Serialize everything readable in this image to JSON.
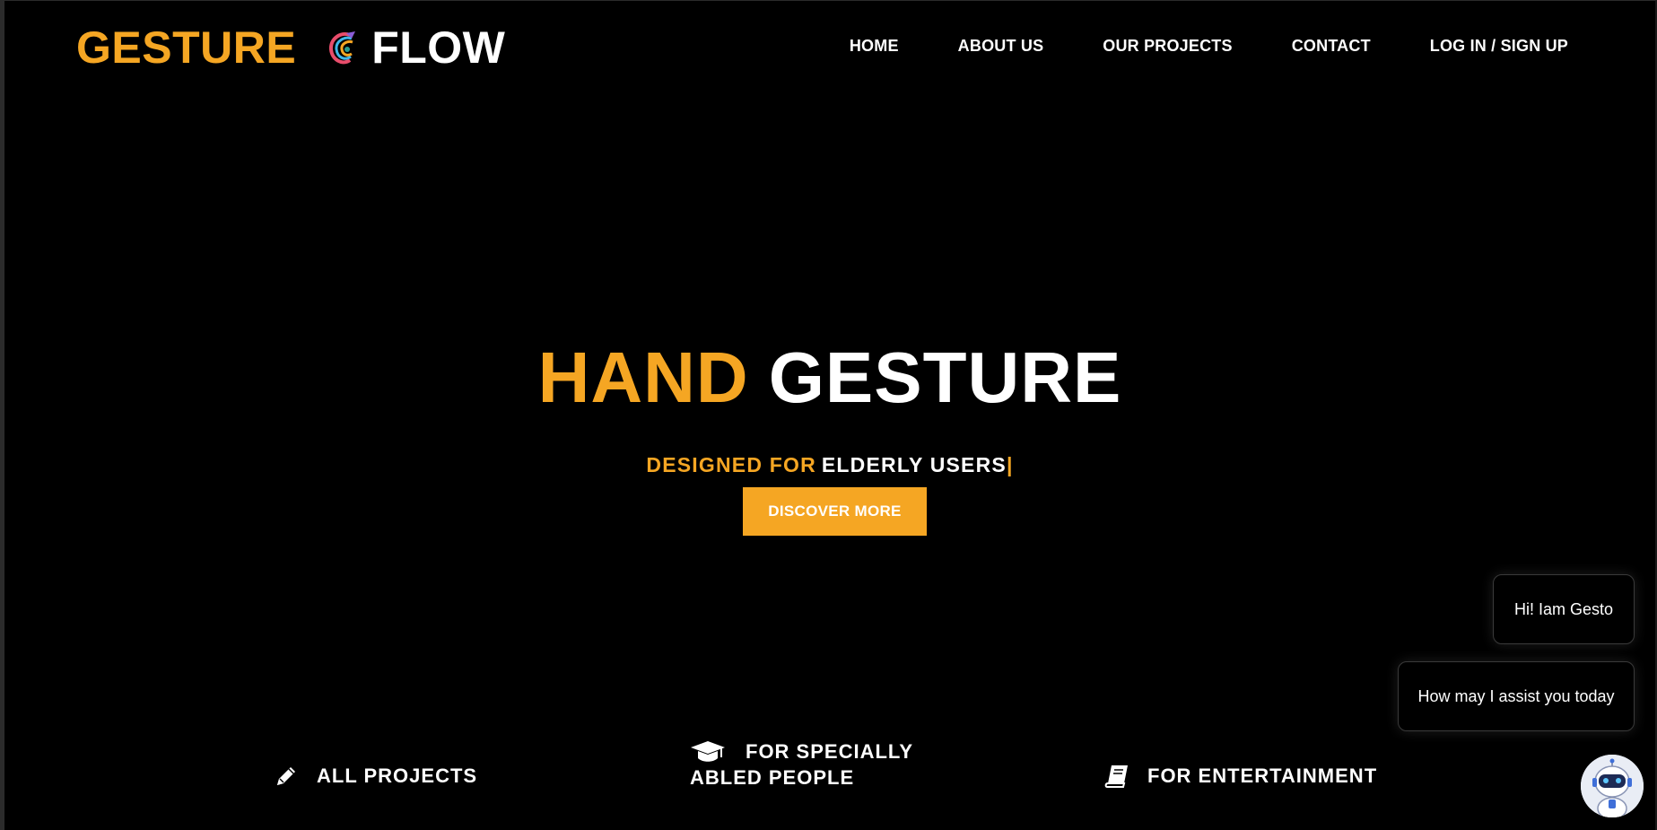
{
  "brand": {
    "word1": "GESTURE",
    "word2": "FLOW",
    "logo_icon": "swirl-hand-logo-icon"
  },
  "nav": {
    "items": [
      "HOME",
      "ABOUT US",
      "OUR PROJECTS",
      "CONTACT",
      "LOG IN / SIGN UP"
    ]
  },
  "hero": {
    "title_orange": "HAND",
    "title_white": "GESTURE",
    "subtitle_orange": "DESIGNED FOR",
    "subtitle_white": "ELDERLY USERS",
    "cursor": "|",
    "cta_label": "DISCOVER MORE"
  },
  "features": [
    {
      "icon": "pencil-icon",
      "label": "ALL PROJECTS"
    },
    {
      "icon": "graduation-cap-icon",
      "label_line1": "FOR SPECIALLY",
      "label_line2": "ABLED PEOPLE"
    },
    {
      "icon": "book-icon",
      "label": "FOR ENTERTAINMENT"
    }
  ],
  "chat": {
    "bubble_1": "Hi! Iam Gesto",
    "bubble_2": "How may I assist you today",
    "avatar_icon": "robot-avatar-icon"
  },
  "colors": {
    "accent": "#f5a623",
    "background": "#000000",
    "text": "#ffffff"
  }
}
